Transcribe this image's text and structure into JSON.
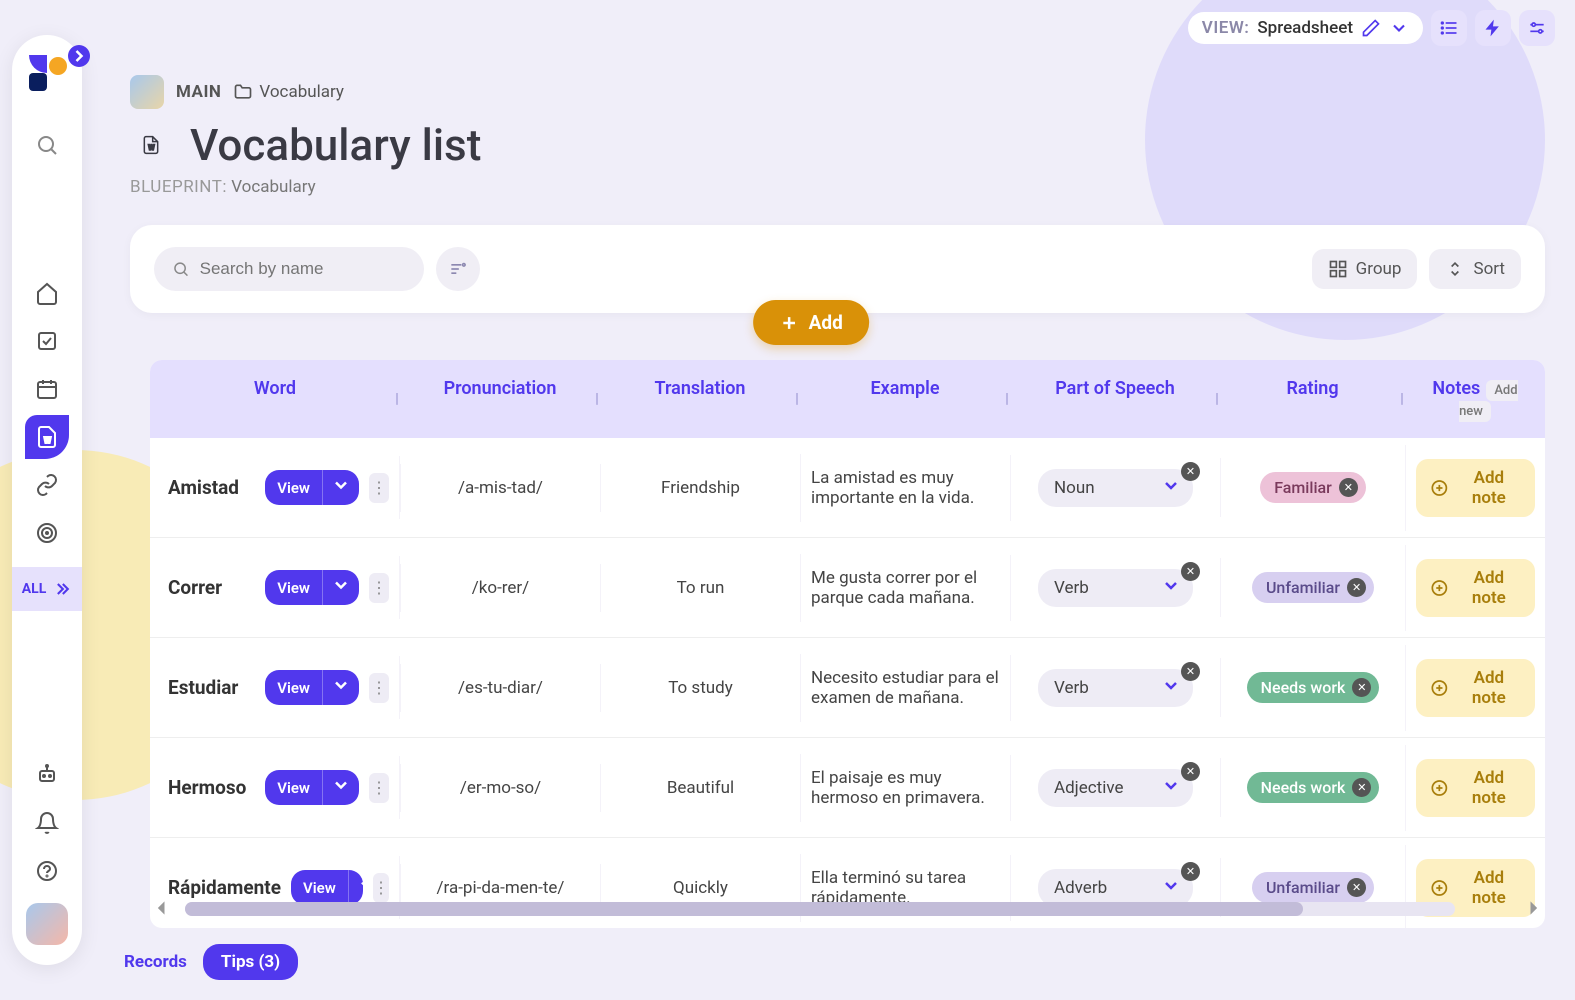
{
  "topbar": {
    "view_label": "VIEW:",
    "view_name": "Spreadsheet"
  },
  "sidebar": {
    "all_label": "ALL"
  },
  "breadcrumb": {
    "main": "MAIN",
    "folder": "Vocabulary"
  },
  "page": {
    "title": "Vocabulary list",
    "blueprint_label": "BLUEPRINT:",
    "blueprint": "Vocabulary"
  },
  "toolbar": {
    "search_placeholder": "Search by name",
    "group_label": "Group",
    "sort_label": "Sort",
    "add_label": "Add"
  },
  "table": {
    "columns": {
      "word": "Word",
      "pronunciation": "Pronunciation",
      "translation": "Translation",
      "example": "Example",
      "pos": "Part of Speech",
      "rating": "Rating",
      "notes": "Notes",
      "add_new": "Add new"
    },
    "view_btn": "View",
    "add_note": "Add note",
    "rows": [
      {
        "word": "Amistad",
        "pron": "/a-mis-tad/",
        "trans": "Friendship",
        "example": "La amistad es muy importante en la vida.",
        "pos": "Noun",
        "rating": "Familiar",
        "rating_class": "familiar"
      },
      {
        "word": "Correr",
        "pron": "/ko-rer/",
        "trans": "To run",
        "example": "Me gusta correr por el parque cada mañana.",
        "pos": "Verb",
        "rating": "Unfamiliar",
        "rating_class": "unfamiliar"
      },
      {
        "word": "Estudiar",
        "pron": "/es-tu-diar/",
        "trans": "To study",
        "example": "Necesito estudiar para el examen de mañana.",
        "pos": "Verb",
        "rating": "Needs work",
        "rating_class": "needswork"
      },
      {
        "word": "Hermoso",
        "pron": "/er-mo-so/",
        "trans": "Beautiful",
        "example": "El paisaje es muy hermoso en primavera.",
        "pos": "Adjective",
        "rating": "Needs work",
        "rating_class": "needswork"
      },
      {
        "word": "Rápidamente",
        "pron": "/ra-pi-da-men-te/",
        "trans": "Quickly",
        "example": "Ella terminó su tarea rápidamente.",
        "pos": "Adverb",
        "rating": "Unfamiliar",
        "rating_class": "unfamiliar"
      }
    ]
  },
  "tabs": {
    "records": "Records",
    "tips": "Tips (3)"
  }
}
